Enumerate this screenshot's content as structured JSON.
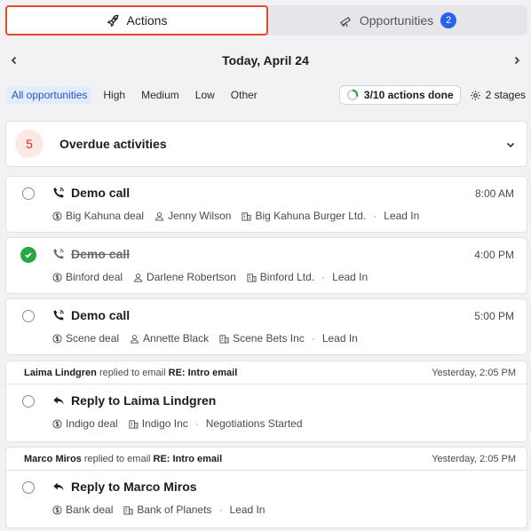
{
  "tabs": [
    {
      "label": "Actions",
      "icon": "rocket-icon",
      "active": true
    },
    {
      "label": "Opportunities",
      "icon": "telescope-icon",
      "badge": "2"
    }
  ],
  "date": {
    "title": "Today, April 24"
  },
  "filters": [
    "All opportunities",
    "High",
    "Medium",
    "Low",
    "Other"
  ],
  "progress": {
    "label": "3/10 actions done",
    "fraction": 0.3
  },
  "stages_label": "2 stages",
  "overdue": {
    "count": "5",
    "label": "Overdue activities"
  },
  "activities": [
    {
      "title": "Demo call",
      "time": "8:00 AM",
      "done": false,
      "deal": "Big Kahuna deal",
      "person": "Jenny Wilson",
      "company": "Big Kahuna Burger Ltd.",
      "stage": "Lead In"
    },
    {
      "title": "Demo call",
      "time": "4:00 PM",
      "done": true,
      "deal": "Binford deal",
      "person": "Darlene Robertson",
      "company": "Binford Ltd.",
      "stage": "Lead In"
    },
    {
      "title": "Demo call",
      "time": "5:00 PM",
      "done": false,
      "deal": "Scene deal",
      "person": "Annette Black",
      "company": "Scene Bets Inc",
      "stage": "Lead In"
    }
  ],
  "replies": [
    {
      "sender": "Laima Lindgren",
      "verb": "replied to email",
      "subject": "RE: Intro email",
      "when": "Yesterday, 2:05 PM",
      "title": "Reply to Laima Lindgren",
      "deal": "Indigo deal",
      "company": "Indigo Inc",
      "stage": "Negotiations Started"
    },
    {
      "sender": "Marco Miros",
      "verb": "replied to email",
      "subject": "RE: Intro email",
      "when": "Yesterday, 2:05 PM",
      "title": "Reply to Marco Miros",
      "deal": "Bank deal",
      "company": "Bank of Planets",
      "stage": "Lead In"
    }
  ],
  "colors": {
    "accent": "#2563eb",
    "highlight_border": "#e8482d",
    "success": "#28a745",
    "overdue": "#d22f23"
  }
}
